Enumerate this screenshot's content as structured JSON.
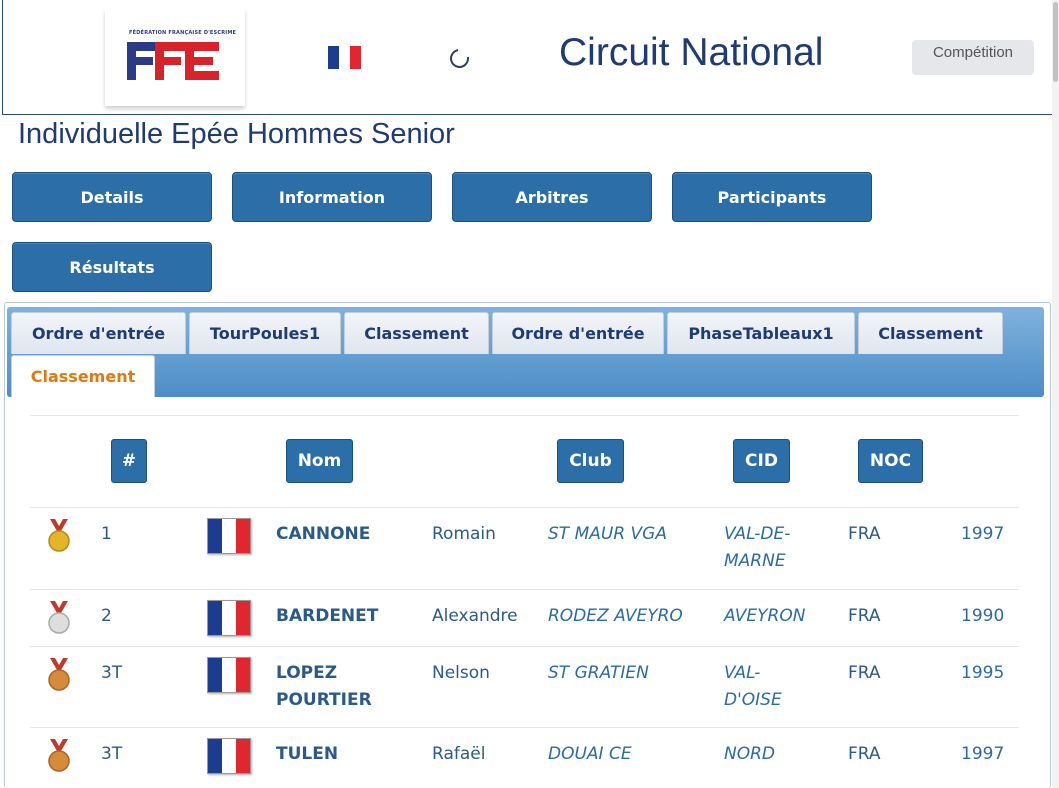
{
  "header": {
    "logo_subtitle": "FÉDÉRATION FRANÇAISE D'ESCRIME",
    "site_title": "Circuit National",
    "competition_button": "Compétition"
  },
  "event_title": "Individuelle Epée Hommes Senior",
  "nav_buttons": [
    "Details",
    "Information",
    "Arbitres",
    "Participants",
    "Résultats"
  ],
  "tabs": [
    "Ordre d'entrée",
    "TourPoules1",
    "Classement",
    "Ordre d'entrée",
    "PhaseTableaux1",
    "Classement",
    "Classement"
  ],
  "active_tab_index": 6,
  "table": {
    "columns": [
      "#",
      "Nom",
      "Club",
      "CID",
      "NOC"
    ],
    "rows": [
      {
        "medal": "gold",
        "rank": "1",
        "last_name": "CANNONE",
        "first_name": "Romain",
        "club": "ST MAUR VGA",
        "cid": "VAL-DE-\nMARNE",
        "noc": "FRA",
        "year": "1997"
      },
      {
        "medal": "silver",
        "rank": "2",
        "last_name": "BARDENET",
        "first_name": "Alexandre",
        "club": "RODEZ AVEYRO",
        "cid": "AVEYRON",
        "noc": "FRA",
        "year": "1990"
      },
      {
        "medal": "bronze",
        "rank": "3T",
        "last_name": "LOPEZ\nPOURTIER",
        "first_name": "Nelson",
        "club": "ST GRATIEN",
        "cid": "VAL-\nD'OISE",
        "noc": "FRA",
        "year": "1995"
      },
      {
        "medal": "bronze",
        "rank": "3T",
        "last_name": "TULEN",
        "first_name": "Rafaël",
        "club": "DOUAI CE",
        "cid": "NORD",
        "noc": "FRA",
        "year": "1997"
      }
    ]
  },
  "colors": {
    "primary_blue": "#2c6ea8",
    "title_navy": "#1f3b73",
    "active_tab_orange": "#e07a10",
    "flag_blue": "#1b3c8f",
    "flag_red": "#e0262e",
    "gold": "#e3b52a",
    "silver": "#c9c9c9",
    "bronze": "#d68a3c"
  }
}
